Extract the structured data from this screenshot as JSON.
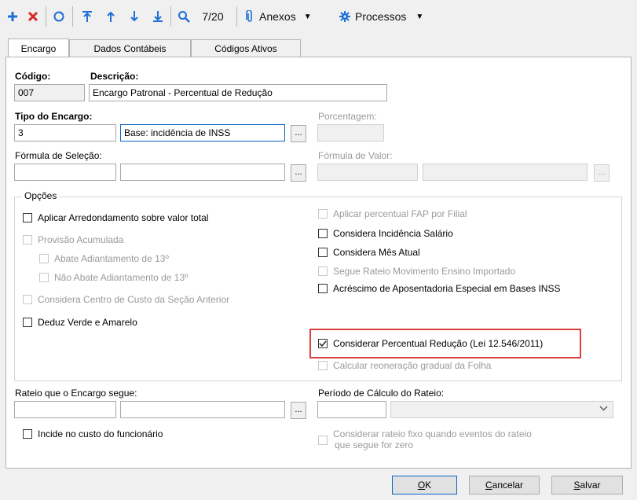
{
  "toolbar": {
    "record_position": "7/20",
    "attachments_label": "Anexos",
    "processes_label": "Processos"
  },
  "tabs": [
    "Encargo",
    "Dados Contábeis",
    "Códigos Ativos"
  ],
  "form": {
    "codigo_label": "Código:",
    "codigo_value": "007",
    "descricao_label": "Descrição:",
    "descricao_value": "Encargo Patronal - Percentual de Redução",
    "tipo_label": "Tipo do Encargo:",
    "tipo_code": "3",
    "tipo_desc": "Base: incidência de INSS",
    "porcentagem_label": "Porcentagem:",
    "formula_selecao_label": "Fórmula de Seleção:",
    "formula_valor_label": "Fórmula de Valor:",
    "dots": "...",
    "opcoes_label": "Opções",
    "rateio_label": "Rateio que o Encargo segue:",
    "periodo_label": "Período de Cálculo do Rateio:"
  },
  "options_left": [
    {
      "label": "Aplicar Arredondamento sobre valor total",
      "checked": false,
      "enabled": true
    },
    {
      "label": "Provisão Acumulada",
      "checked": false,
      "enabled": false
    },
    {
      "label": "Abate Adiantamento de 13º",
      "checked": false,
      "enabled": false
    },
    {
      "label": "Não Abate Adiantamento de 13º",
      "checked": false,
      "enabled": false
    },
    {
      "label": "Considera Centro de Custo da Seção Anterior",
      "checked": false,
      "enabled": false
    },
    {
      "label": "Deduz Verde e Amarelo",
      "checked": false,
      "enabled": true
    }
  ],
  "options_right": [
    {
      "label": "Aplicar percentual FAP por Filial",
      "checked": false,
      "enabled": false
    },
    {
      "label": "Considera Incidência Salário",
      "checked": false,
      "enabled": true
    },
    {
      "label": "Considera Mês Atual",
      "checked": false,
      "enabled": true
    },
    {
      "label": "Segue Rateio Movimento Ensino Importado",
      "checked": false,
      "enabled": false
    },
    {
      "label": "Acréscimo de Aposentadoria Especial em Bases INSS",
      "checked": false,
      "enabled": true
    },
    {
      "label": "Considerar Percentual Redução (Lei 12.546/2011)",
      "checked": true,
      "enabled": true
    },
    {
      "label": "Calcular reoneração gradual da Folha",
      "checked": false,
      "enabled": false
    }
  ],
  "incide_custo": {
    "label": "Incide no custo do funcionário",
    "checked": false
  },
  "rateio_fixo": {
    "line1": "Considerar rateio fixo quando eventos do rateio",
    "line2": "que segue for zero",
    "checked": false
  },
  "buttons": {
    "ok": "OK",
    "cancel": "Cancelar",
    "save": "Salvar"
  },
  "colors": {
    "accent": "#1e6fd6",
    "delete": "#d9262a",
    "highlight": "#d9413f"
  }
}
